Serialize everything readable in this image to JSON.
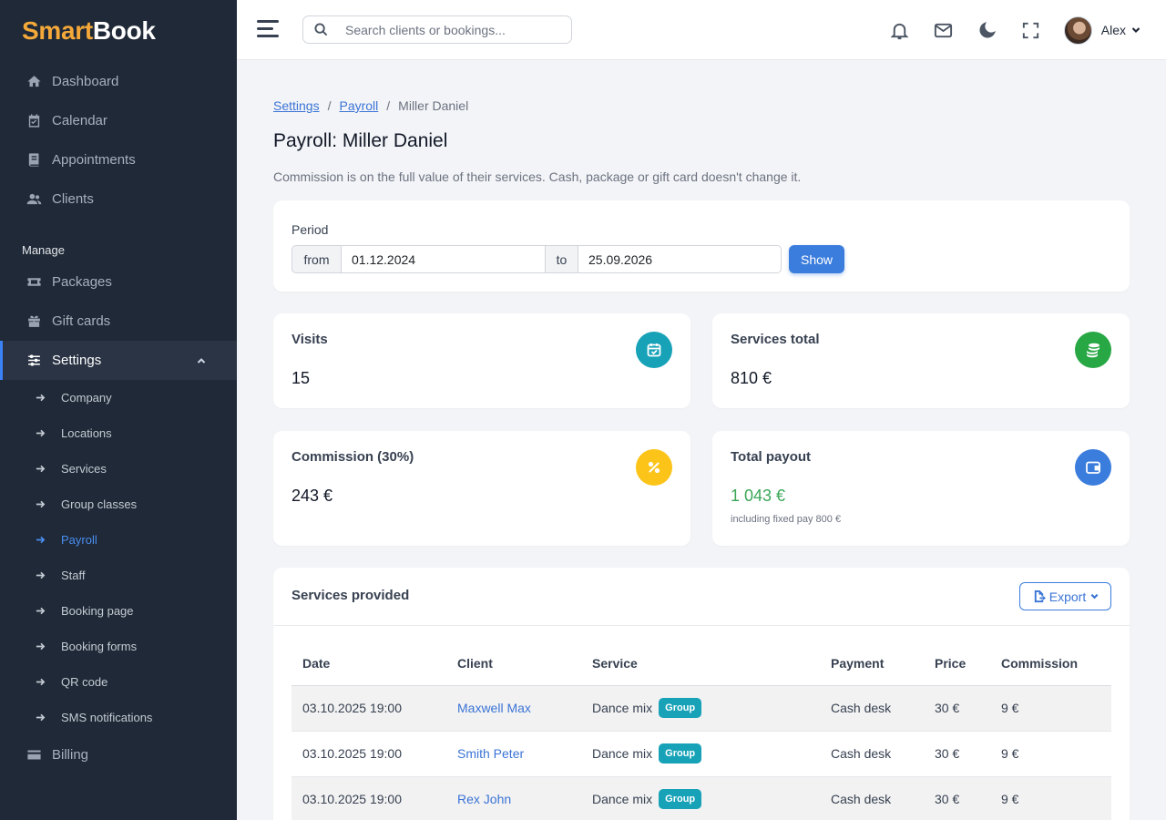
{
  "brand": {
    "part1": "Smart",
    "part2": "Book"
  },
  "sidebar": {
    "main_items": [
      {
        "label": "Dashboard",
        "icon": "home-icon"
      },
      {
        "label": "Calendar",
        "icon": "calendar-icon"
      },
      {
        "label": "Appointments",
        "icon": "book-icon"
      },
      {
        "label": "Clients",
        "icon": "users-icon"
      }
    ],
    "section_label": "Manage",
    "manage_items": [
      {
        "label": "Packages",
        "icon": "ticket-icon"
      },
      {
        "label": "Gift cards",
        "icon": "gift-icon"
      }
    ],
    "settings": {
      "label": "Settings",
      "icon": "sliders-icon",
      "sub_items": [
        {
          "label": "Company"
        },
        {
          "label": "Locations"
        },
        {
          "label": "Services"
        },
        {
          "label": "Group classes"
        },
        {
          "label": "Payroll",
          "active": true
        },
        {
          "label": "Staff"
        },
        {
          "label": "Booking page"
        },
        {
          "label": "Booking forms"
        },
        {
          "label": "QR code"
        },
        {
          "label": "SMS notifications"
        }
      ]
    },
    "billing": {
      "label": "Billing",
      "icon": "credit-card-icon"
    }
  },
  "header": {
    "search_placeholder": "Search clients or bookings...",
    "user_name": "Alex"
  },
  "breadcrumb": {
    "item1": "Settings",
    "item2": "Payroll",
    "current": "Miller Daniel",
    "separator": "/"
  },
  "page": {
    "title": "Payroll: Miller Daniel",
    "description": "Commission is on the full value of their services. Cash, package or gift card doesn't change it."
  },
  "period": {
    "label": "Period",
    "from_label": "from",
    "from_value": "01.12.2024",
    "to_label": "to",
    "to_value": "25.09.2026",
    "show_label": "Show"
  },
  "stats": {
    "visits": {
      "title": "Visits",
      "value": "15",
      "color": "#17a2b8"
    },
    "services_total": {
      "title": "Services total",
      "value": "810 €",
      "color": "#28a745"
    },
    "commission": {
      "title": "Commission (30%)",
      "value": "243 €",
      "color": "#fcc419"
    },
    "payout": {
      "title": "Total payout",
      "value": "1 043 €",
      "sub": "including fixed pay 800 €",
      "color": "#3b7ddd"
    }
  },
  "services": {
    "title": "Services provided",
    "export_label": "Export",
    "columns": [
      "Date",
      "Client",
      "Service",
      "Payment",
      "Price",
      "Commission"
    ],
    "rows": [
      {
        "date": "03.10.2025 19:00",
        "client": "Maxwell Max",
        "service": "Dance mix",
        "badge": "Group",
        "payment": "Cash desk",
        "price": "30 €",
        "commission": "9 €"
      },
      {
        "date": "03.10.2025 19:00",
        "client": "Smith Peter",
        "service": "Dance mix",
        "badge": "Group",
        "payment": "Cash desk",
        "price": "30 €",
        "commission": "9 €"
      },
      {
        "date": "03.10.2025 19:00",
        "client": "Rex John",
        "service": "Dance mix",
        "badge": "Group",
        "payment": "Cash desk",
        "price": "30 €",
        "commission": "9 €"
      }
    ]
  }
}
